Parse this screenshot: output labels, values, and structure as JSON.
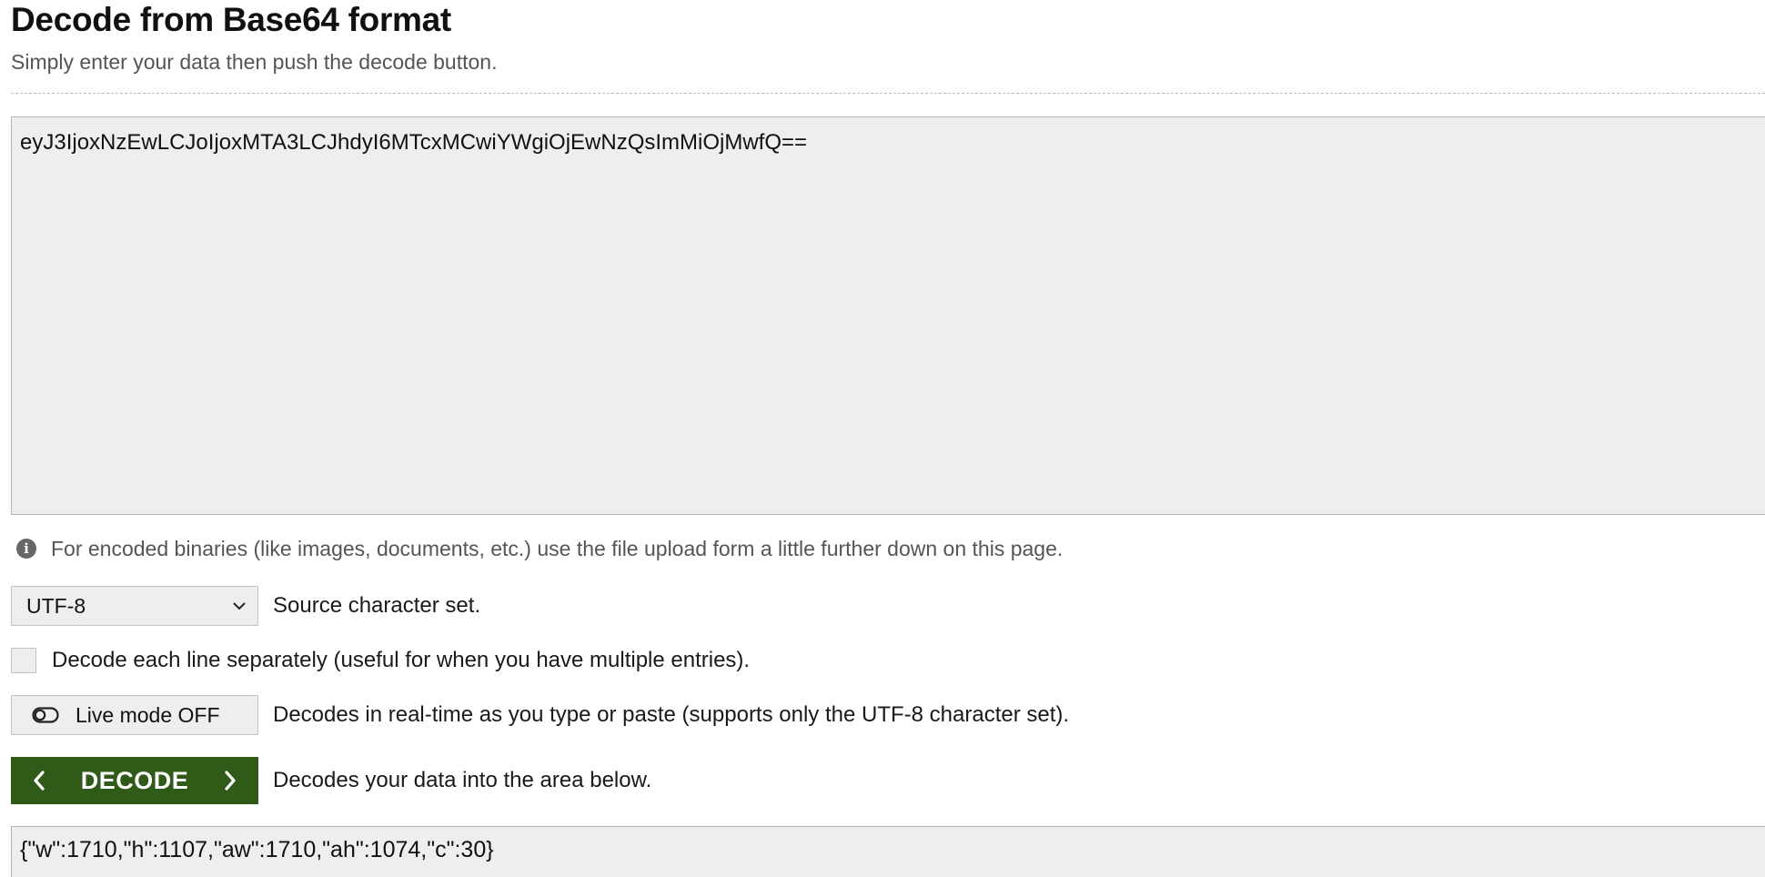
{
  "header": {
    "title": "Decode from Base64 format",
    "subtitle": "Simply enter your data then push the decode button."
  },
  "input": {
    "value": "eyJ3IjoxNzEwLCJoIjoxMTA3LCJhdyI6MTcxMCwiYWgiOjEwNzQsImMiOjMwfQ=="
  },
  "info": {
    "icon": "info-icon",
    "text": "For encoded binaries (like images, documents, etc.) use the file upload form a little further down on this page."
  },
  "charset": {
    "selected": "UTF-8",
    "description": "Source character set."
  },
  "lines": {
    "checked": false,
    "label": "Decode each line separately (useful for when you have multiple entries)."
  },
  "live_mode": {
    "label": "Live mode OFF",
    "icon": "toggle-off-icon",
    "description": "Decodes in real-time as you type or paste (supports only the UTF-8 character set)."
  },
  "decode": {
    "label": "DECODE",
    "description": "Decodes your data into the area below.",
    "color": "#2f5a17"
  },
  "output": {
    "value": "{\"w\":1710,\"h\":1107,\"aw\":1710,\"ah\":1074,\"c\":30}"
  }
}
